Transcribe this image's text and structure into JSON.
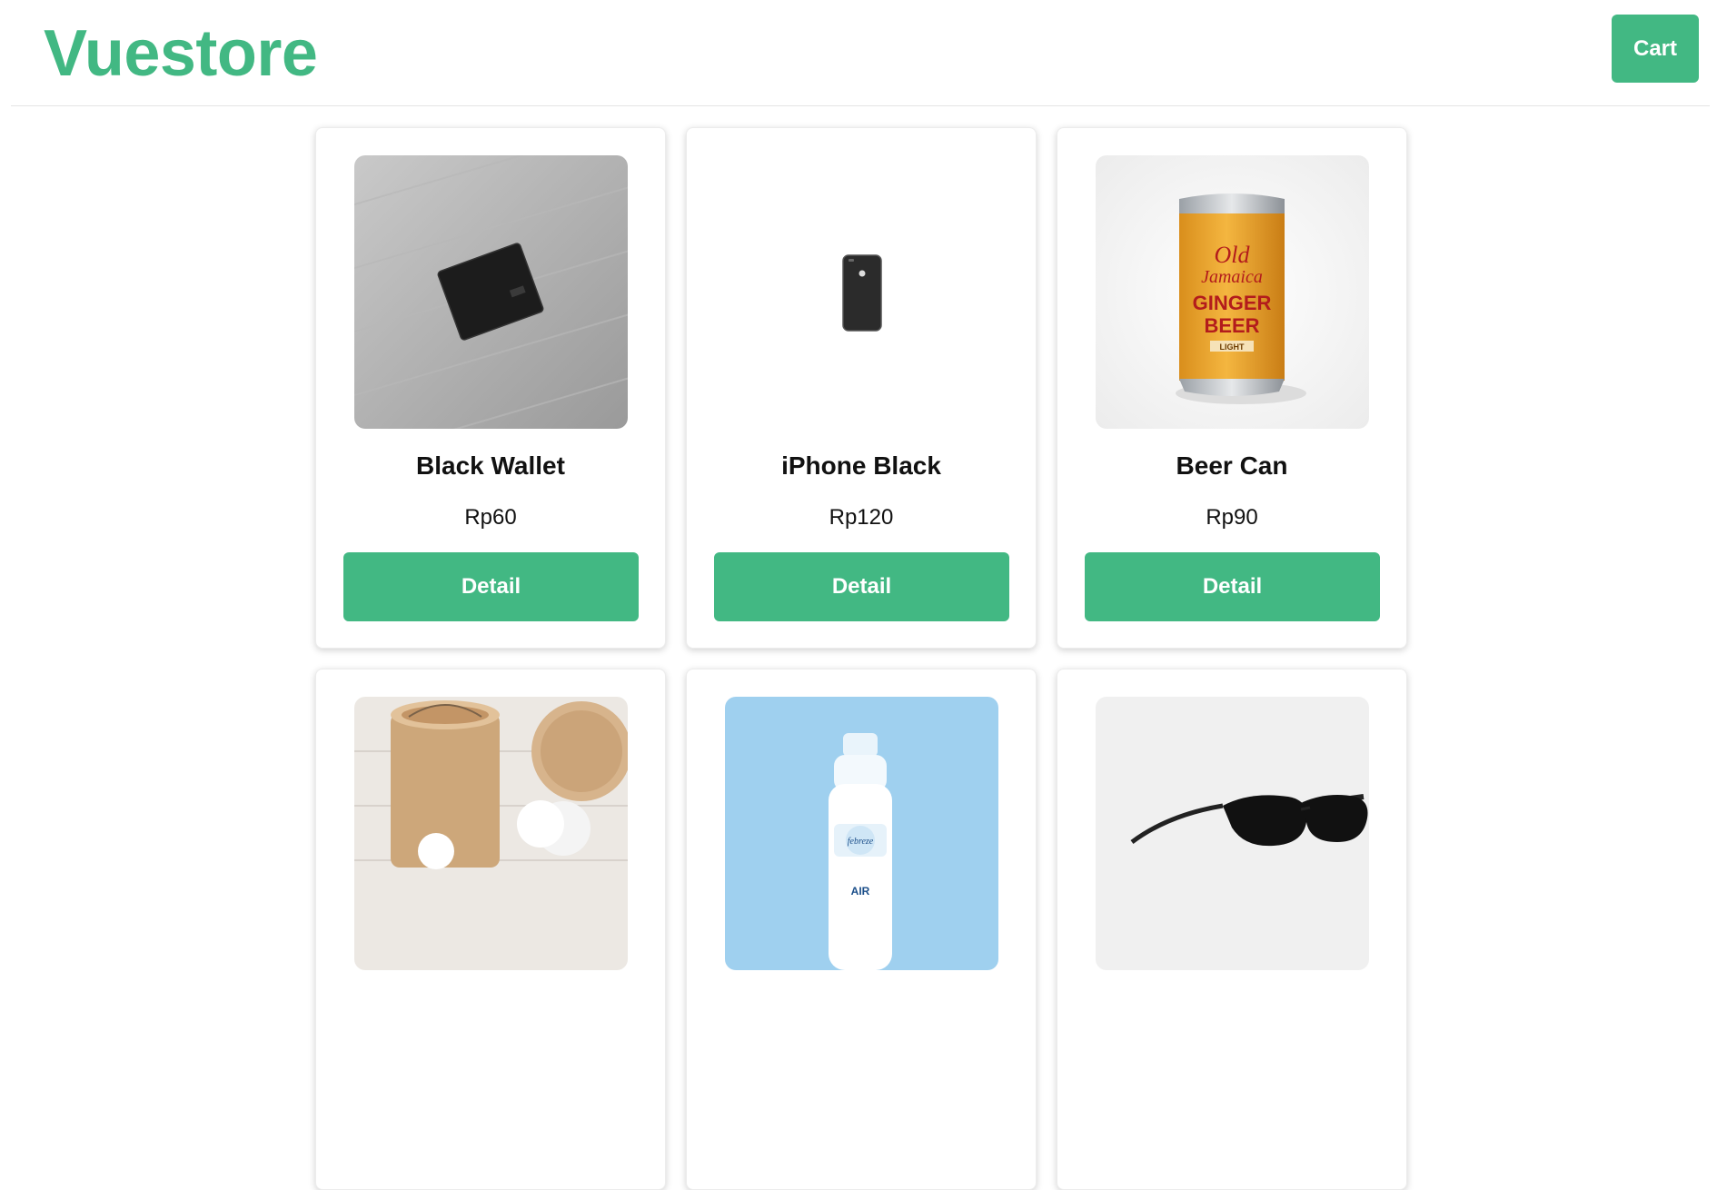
{
  "header": {
    "brand": "Vuestore",
    "cart_label": "Cart"
  },
  "products": [
    {
      "name": "Black Wallet",
      "price": "Rp60",
      "button": "Detail",
      "image": "wallet-photo"
    },
    {
      "name": "iPhone Black",
      "price": "Rp120",
      "button": "Detail",
      "image": "phone-photo"
    },
    {
      "name": "Beer Can",
      "price": "Rp90",
      "button": "Detail",
      "image": "beer-can-photo"
    },
    {
      "name": "",
      "price": "",
      "button": "",
      "image": "bamboo-container-photo"
    },
    {
      "name": "",
      "price": "",
      "button": "",
      "image": "air-freshener-photo"
    },
    {
      "name": "",
      "price": "",
      "button": "",
      "image": "sunglasses-photo"
    }
  ],
  "colors": {
    "accent": "#42b883",
    "text": "#111111",
    "border": "#e4e4e4"
  }
}
